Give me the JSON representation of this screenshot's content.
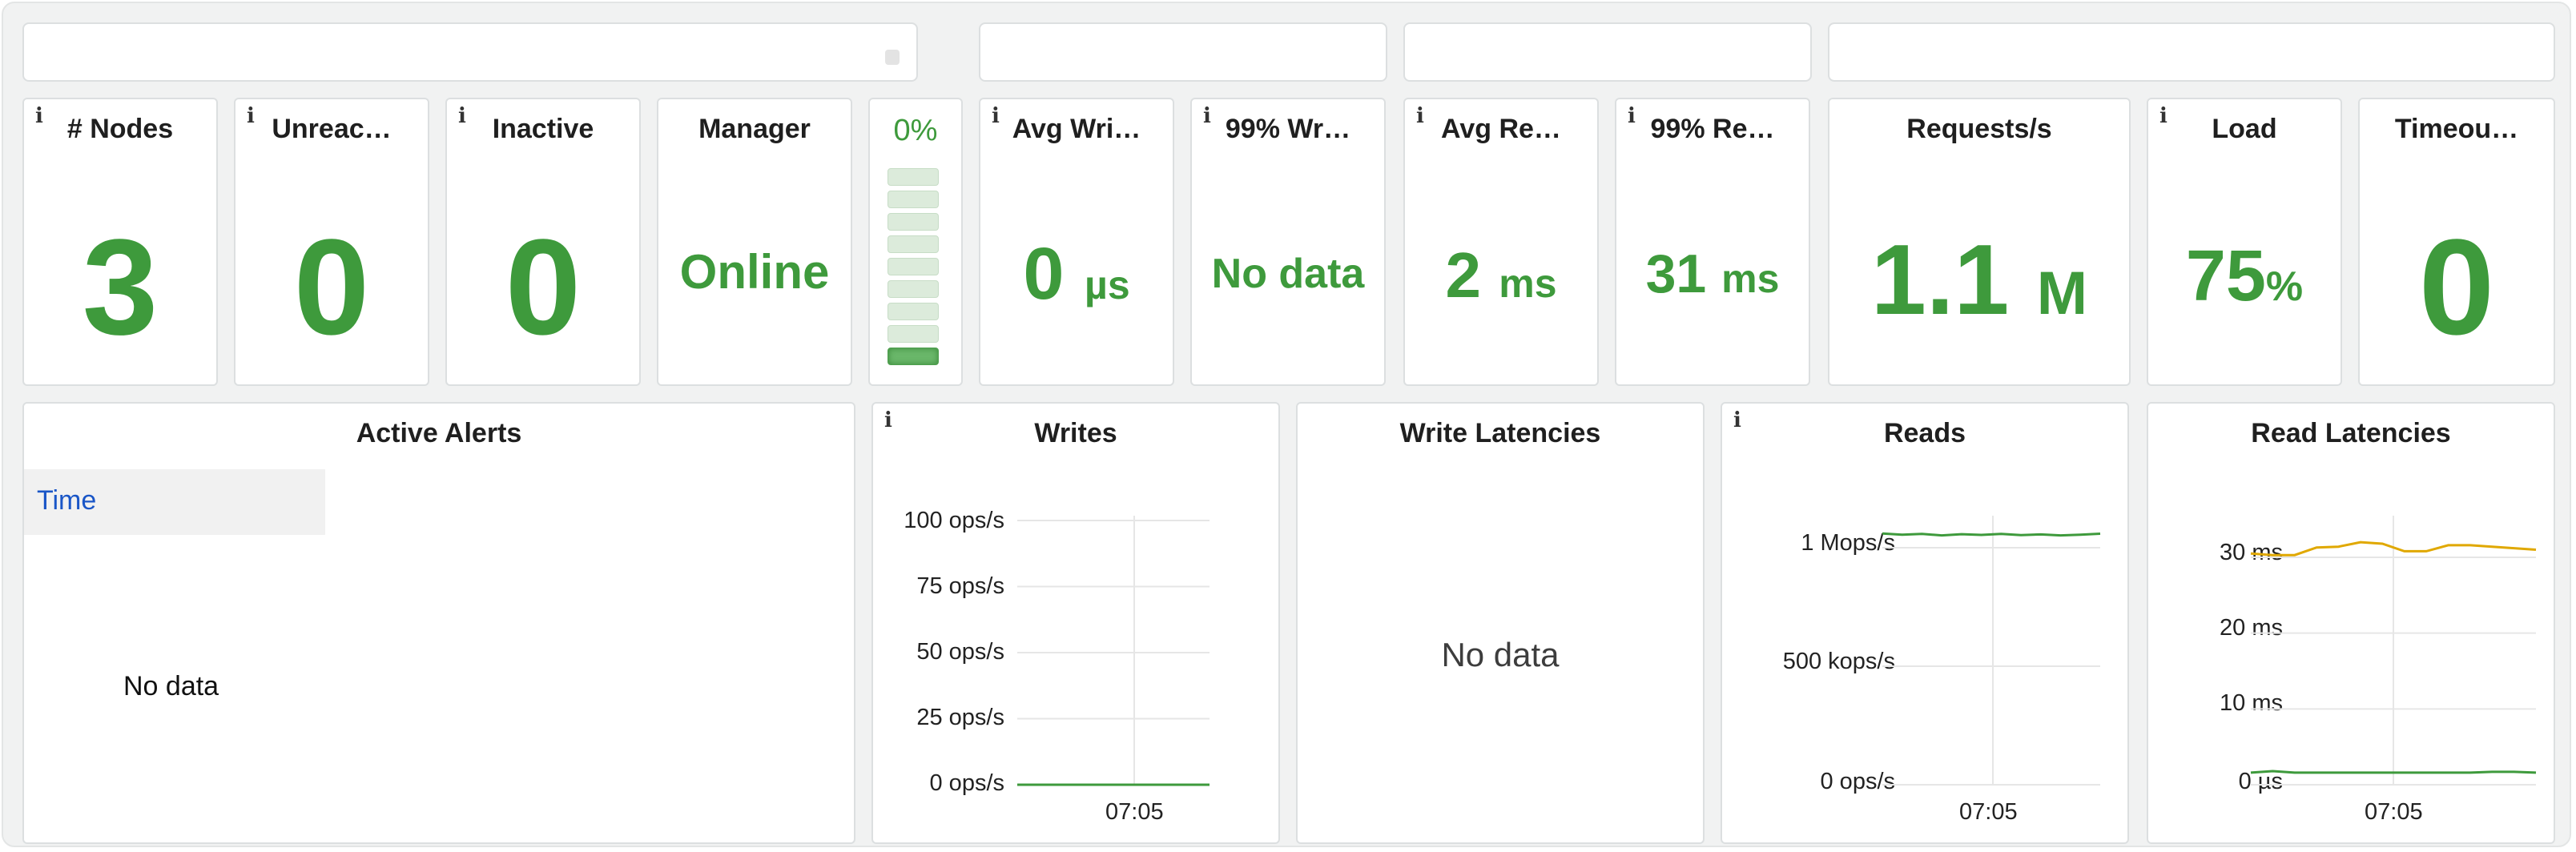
{
  "top_bar": {
    "lock_icon": "lock-icon"
  },
  "stats": {
    "nodes": {
      "title": "# Nodes",
      "value": "3"
    },
    "unreachable": {
      "title": "Unreac…",
      "value": "0"
    },
    "inactive": {
      "title": "Inactive",
      "value": "0"
    },
    "manager": {
      "title": "Manager",
      "value": "Online"
    },
    "gauge": {
      "percent_label": "0%",
      "level_fraction": 0.0,
      "segments_lit": 1,
      "segments_total": 9
    },
    "avg_write": {
      "title": "Avg Wri…",
      "value": "0",
      "unit": "µs"
    },
    "p99_write": {
      "title": "99% Wr…",
      "value": "No data"
    },
    "avg_read": {
      "title": "Avg Re…",
      "value": "2",
      "unit": "ms"
    },
    "p99_read": {
      "title": "99% Re…",
      "value": "31",
      "unit": "ms"
    },
    "requests": {
      "title": "Requests/s",
      "value": "1.1",
      "unit": "M"
    },
    "load": {
      "title": "Load",
      "value": "75",
      "unit": "%"
    },
    "timeouts": {
      "title": "Timeou…",
      "value": "0"
    }
  },
  "alerts": {
    "title": "Active Alerts",
    "column_header": "Time",
    "empty_text": "No data"
  },
  "writes": {
    "title": "Writes",
    "y_ticks": [
      "100 ops/s",
      "75 ops/s",
      "50 ops/s",
      "25 ops/s",
      "0 ops/s"
    ],
    "x_tick": "07:05"
  },
  "write_latencies": {
    "title": "Write Latencies",
    "empty_text": "No data"
  },
  "reads": {
    "title": "Reads",
    "y_ticks": [
      "1 Mops/s",
      "500 kops/s",
      "0 ops/s"
    ],
    "x_tick": "07:05"
  },
  "read_latencies": {
    "title": "Read Latencies",
    "y_ticks": [
      "30 ms",
      "20 ms",
      "10 ms",
      "0 µs"
    ],
    "x_tick": "07:05"
  },
  "colors": {
    "green": "#3e9a3c",
    "yellow": "#e0a800",
    "link_blue": "#1a56c7"
  },
  "chart_data": [
    {
      "type": "line",
      "title": "Writes",
      "ylim": [
        0,
        100
      ],
      "y_unit": "ops/s",
      "x_tick_labels": [
        "07:05"
      ],
      "series": [
        {
          "values": [
            0,
            0,
            0,
            0,
            0,
            0,
            0,
            0,
            0,
            0,
            0,
            0
          ],
          "color": "#3e9a3c"
        }
      ]
    },
    {
      "type": "line",
      "title": "Reads",
      "ylim": [
        0,
        1000000
      ],
      "y_unit": "ops/s",
      "x_tick_labels": [
        "07:05"
      ],
      "series": [
        {
          "values": [
            1060000,
            1055000,
            1058000,
            1052000,
            1057000,
            1054000,
            1058000,
            1053000,
            1056000,
            1052000,
            1055000,
            1059000
          ],
          "color": "#3e9a3c"
        }
      ]
    },
    {
      "type": "line",
      "title": "Read Latencies",
      "ylim": [
        0,
        30
      ],
      "y_unit": "ms",
      "x_tick_labels": [
        "07:05"
      ],
      "series": [
        {
          "values": [
            30.5,
            30.3,
            30.3,
            31.3,
            31.4,
            32.0,
            31.8,
            30.8,
            30.8,
            31.6,
            31.6,
            31.4,
            31.2,
            31.0
          ],
          "color": "#e0a800"
        },
        {
          "values": [
            1.6,
            1.8,
            1.6,
            1.6,
            1.6,
            1.6,
            1.6,
            1.6,
            1.6,
            1.6,
            1.6,
            1.7,
            1.7,
            1.6
          ],
          "color": "#3e9a3c"
        }
      ]
    }
  ]
}
